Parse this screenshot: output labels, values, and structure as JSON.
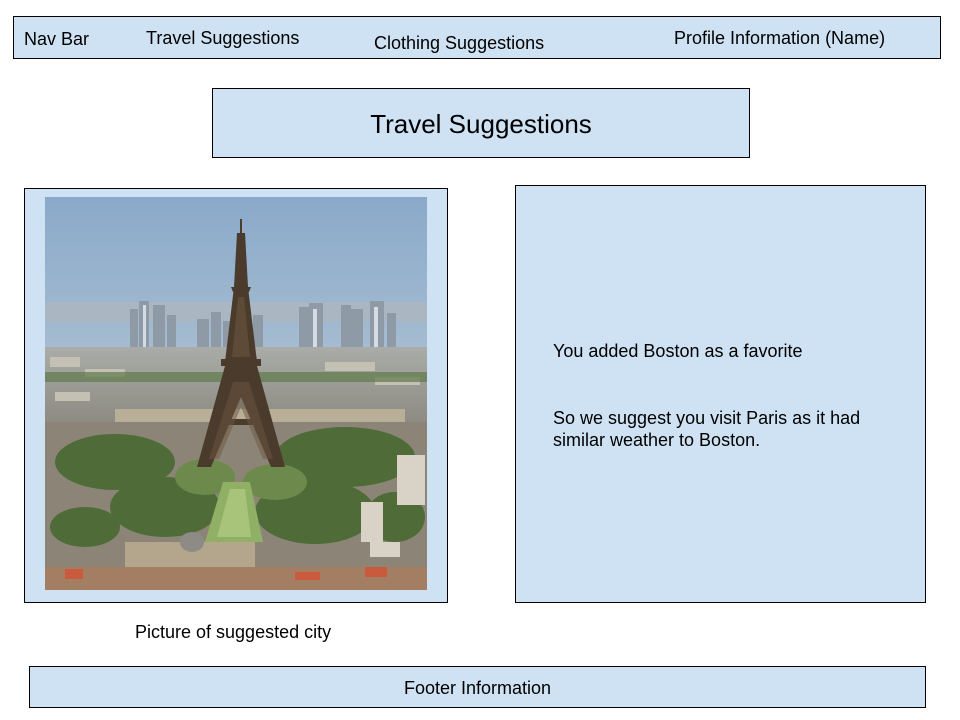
{
  "nav": {
    "label": "Nav Bar",
    "travel": "Travel Suggestions",
    "clothing": "Clothing Suggestions",
    "profile": "Profile Information (Name)"
  },
  "main": {
    "title": "Travel Suggestions",
    "favorite_text": "You added Boston as a favorite",
    "suggestion_line1": "So we suggest you visit Paris as it had",
    "suggestion_line2": "similar weather to Boston."
  },
  "photo": {
    "caption": "Picture of suggested city",
    "subject": "eiffel-tower-paris-cityscape"
  },
  "footer": {
    "text": "Footer Information"
  },
  "colors": {
    "box_fill": "#cfe2f3",
    "border": "#000000",
    "text": "#000000"
  }
}
